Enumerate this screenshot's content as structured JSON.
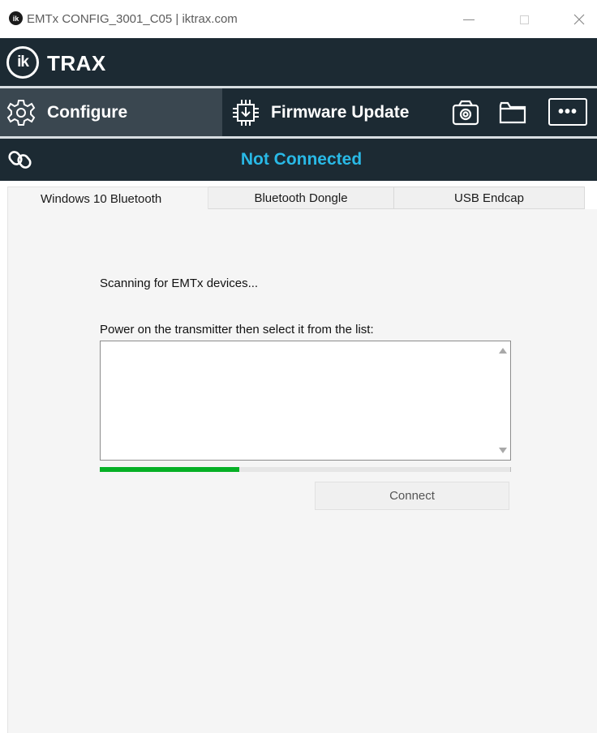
{
  "window": {
    "title": "EMTx CONFIG_3001_C05 | iktrax.com",
    "app_icon_text": "ik",
    "close_glyph": "✕"
  },
  "brand": {
    "logo_text": "ik",
    "name": "TRAX"
  },
  "toolbar": {
    "configure_label": "Configure",
    "firmware_label": "Firmware Update",
    "more_label": "•••",
    "icons": [
      "gear-icon",
      "chip-download-icon",
      "camera-icon",
      "folder-icon",
      "more-icon"
    ]
  },
  "status": {
    "text": "Not Connected",
    "color": "#29b9e6",
    "icon": "link-icon"
  },
  "tabs": [
    {
      "label": "Windows 10 Bluetooth",
      "active": true
    },
    {
      "label": "Bluetooth Dongle",
      "active": false
    },
    {
      "label": "USB Endcap",
      "active": false
    }
  ],
  "main": {
    "scan_text": "Scanning for EMTx devices...",
    "instruction": "Power on the transmitter then select it from the list:",
    "device_list": [],
    "progress_fraction": 0.34,
    "progress_color": "#06b025",
    "connect_label": "Connect"
  },
  "colors": {
    "header_bg": "#1c2a33",
    "active_tool_bg": "#3a4750"
  }
}
